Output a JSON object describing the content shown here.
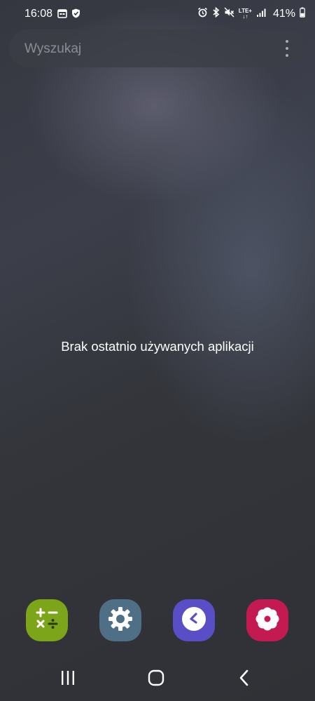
{
  "status_bar": {
    "time": "16:08",
    "battery_percent": "41%",
    "network_type": "LTE+",
    "left_icons": [
      "calendar-icon",
      "shield-icon"
    ],
    "right_icons": [
      "alarm-icon",
      "bluetooth-icon",
      "mute-icon",
      "lte-icon",
      "signal-icon",
      "battery-icon"
    ]
  },
  "search": {
    "placeholder": "Wyszukaj",
    "more_icon": "more-vertical-icon"
  },
  "recents": {
    "empty_message": "Brak ostatnio używanych aplikacji"
  },
  "suggested_apps": [
    {
      "icon": "calculator-icon",
      "color": "#7da519"
    },
    {
      "icon": "settings-icon",
      "color": "#4f6f86"
    },
    {
      "icon": "clock-icon",
      "color": "#5a4ec6"
    },
    {
      "icon": "gallery-icon",
      "color": "#c41a52"
    }
  ],
  "nav_bar": {
    "recents_icon": "recents-icon",
    "home_icon": "home-icon",
    "back_icon": "back-icon"
  }
}
